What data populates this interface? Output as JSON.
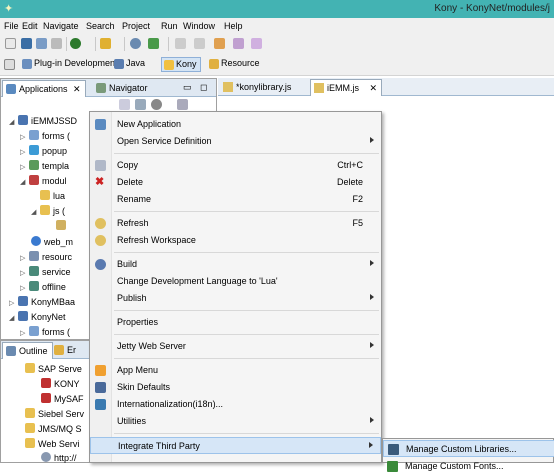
{
  "window": {
    "title": "Kony - KonyNet/modules/j"
  },
  "menubar": [
    "File",
    "Edit",
    "Navigate",
    "Search",
    "Project",
    "Run",
    "Window",
    "Help"
  ],
  "perspectives": [
    {
      "label": "Plug-in Development"
    },
    {
      "label": "Java"
    },
    {
      "label": "Kony",
      "active": true
    },
    {
      "label": "Resource"
    }
  ],
  "left_tabs": [
    {
      "label": "Applications",
      "selected": true
    },
    {
      "label": "Navigator"
    }
  ],
  "tree": [
    {
      "label": "iEMMJSSD",
      "icon": "project-icon"
    },
    {
      "label": "forms (",
      "icon": "forms-icon"
    },
    {
      "label": "popup",
      "icon": "popup-icon"
    },
    {
      "label": "templa",
      "icon": "templates-icon"
    },
    {
      "label": "modul",
      "icon": "modules-icon"
    },
    {
      "label": "lua",
      "icon": "lua-folder-icon"
    },
    {
      "label": "js (",
      "icon": "js-folder-icon"
    },
    {
      "label": "web_m",
      "icon": "web-icon"
    },
    {
      "label": "resourc",
      "icon": "resources-icon"
    },
    {
      "label": "service",
      "icon": "services-icon"
    },
    {
      "label": "offline",
      "icon": "offline-icon"
    },
    {
      "label": "KonyMBaa",
      "icon": "project-icon"
    },
    {
      "label": "KonyNet",
      "icon": "project-icon"
    },
    {
      "label": "forms (",
      "icon": "forms-icon"
    }
  ],
  "bottom_tabs": [
    {
      "label": "Outline",
      "selected": true
    },
    {
      "label": "Er"
    }
  ],
  "outline_tree": [
    {
      "label": "SAP Serve"
    },
    {
      "label": "KONY"
    },
    {
      "label": "MySAF"
    },
    {
      "label": "Siebel Serv"
    },
    {
      "label": "JMS/MQ S"
    },
    {
      "label": "Web Servi"
    },
    {
      "label": "http://"
    }
  ],
  "editor_tabs": [
    {
      "label": "*konylibrary.js"
    },
    {
      "label": "iEMM.js",
      "selected": true
    }
  ],
  "context_menu": {
    "items": [
      {
        "label": "New Application",
        "shortcut": "",
        "submenu": false
      },
      {
        "label": "Open Service Definition",
        "shortcut": "",
        "submenu": true
      },
      {
        "label": "Copy",
        "shortcut": "Ctrl+C",
        "submenu": false
      },
      {
        "label": "Delete",
        "shortcut": "Delete",
        "submenu": false
      },
      {
        "label": "Rename",
        "shortcut": "F2",
        "submenu": false
      },
      {
        "label": "Refresh",
        "shortcut": "F5",
        "submenu": false
      },
      {
        "label": "Refresh Workspace",
        "shortcut": "",
        "submenu": false
      },
      {
        "label": "Build",
        "shortcut": "",
        "submenu": true
      },
      {
        "label": "Change Development Language to 'Lua'",
        "shortcut": "",
        "submenu": false
      },
      {
        "label": "Publish",
        "shortcut": "",
        "submenu": true
      },
      {
        "label": "Properties",
        "shortcut": "",
        "submenu": false
      },
      {
        "label": "Jetty Web Server",
        "shortcut": "",
        "submenu": true
      },
      {
        "label": "App Menu",
        "shortcut": "",
        "submenu": false
      },
      {
        "label": "Skin Defaults",
        "shortcut": "",
        "submenu": false
      },
      {
        "label": "Internationalization(i18n)...",
        "shortcut": "",
        "submenu": false
      },
      {
        "label": "Utilities",
        "shortcut": "",
        "submenu": true
      },
      {
        "label": "Integrate Third Party",
        "shortcut": "",
        "submenu": true
      }
    ]
  },
  "submenu": {
    "items": [
      {
        "label": "Manage Custom Libraries..."
      },
      {
        "label": "Manage Custom Fonts..."
      }
    ]
  },
  "colors": {
    "titlebar": "#43b3b3",
    "menu_highlight": "#d6e6f7",
    "delete_icon": "#cc2222"
  }
}
